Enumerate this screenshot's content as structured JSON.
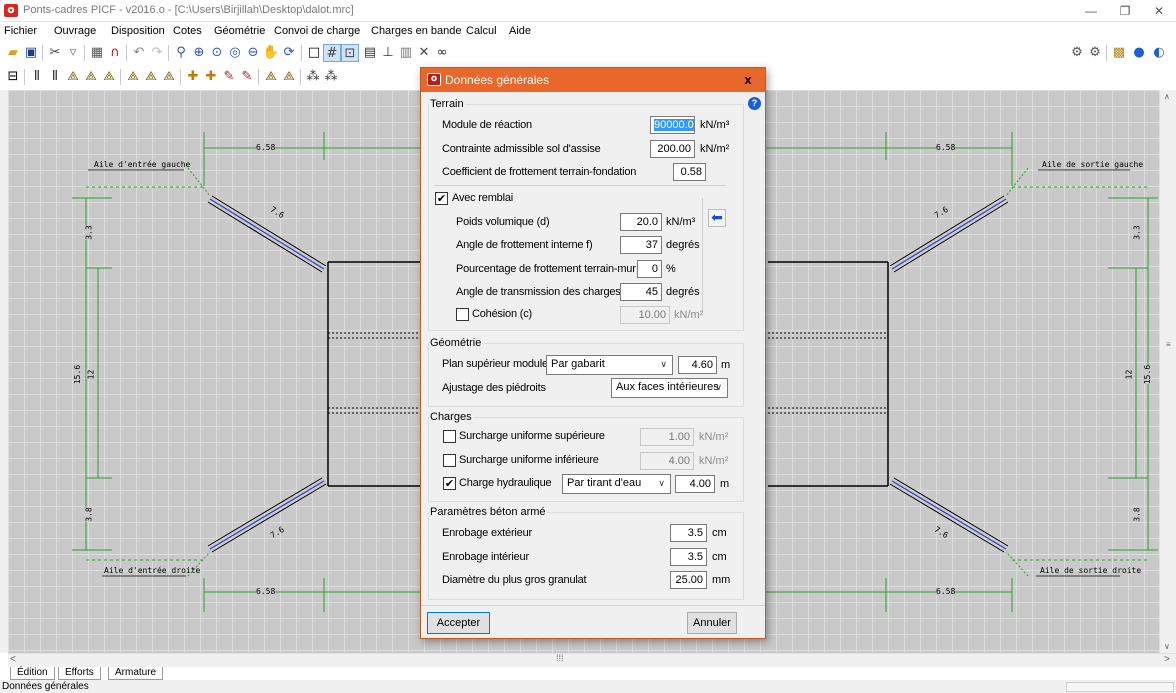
{
  "window": {
    "title": "Ponts-cadres PICF - v2016.o - [C:\\Users\\Birjillah\\Desktop\\dalot.mrc]",
    "controls": [
      "—",
      "❐",
      "✕"
    ]
  },
  "menu": [
    "Fichier",
    "Ouvrage",
    "Disposition",
    "Cotes",
    "Géométrie",
    "Convoi de charge",
    "Charges en bande",
    "Calcul",
    "Aide"
  ],
  "toolbar1_icons": [
    "open-icon",
    "save-icon",
    "cut-icon",
    "paste-icon",
    "image-icon",
    "magnet-icon",
    "undo-icon",
    "redo-icon",
    "zoom-in-icon",
    "zoom-all-icon",
    "zoom-window-icon",
    "zoom-extents-icon",
    "zoom-prev-icon",
    "pan-icon",
    "redraw-icon",
    "frame-icon",
    "grid-icon",
    "snap-icon",
    "print-icon",
    "elevation-icon",
    "preview-icon",
    "tools-icon",
    "binoculars-icon"
  ],
  "toolbar_right_icons": [
    "settings-icon",
    "options-icon",
    "calculate-icon",
    "help-icon",
    "internet-icon"
  ],
  "canvas": {
    "labels": {
      "wing_in_left": "Aile d'entrée gauche",
      "wing_out_left": "Aile de sortie gauche",
      "wing_in_right": "Aile d'entrée droite",
      "wing_out_right": "Aile de sortie droite",
      "dim_658": "6.58",
      "dim_76": "7.6",
      "dim_33": "3.3",
      "dim_38": "3.8",
      "dim_156": "15.6",
      "dim_12": "12"
    }
  },
  "tabs": [
    "Édition",
    "Efforts",
    "Armature"
  ],
  "status": "Données générales",
  "dialog": {
    "title": "Données générales",
    "close": "x",
    "help": "?",
    "terrain": {
      "title": "Terrain",
      "module_label": "Module de réaction",
      "module_value": "90000.0",
      "module_unit": "kN/m³",
      "contrainte_label": "Contrainte admissible sol d'assise",
      "contrainte_value": "200.00",
      "contrainte_unit": "kN/m²",
      "frottement_label": "Coefficient de frottement terrain-fondation",
      "frottement_value": "0.58",
      "remblai_label": "Avec remblai",
      "remblai_checked": true,
      "poids_label": "Poids volumique (d)",
      "poids_value": "20.0",
      "poids_unit": "kN/m³",
      "angle_label": "Angle de frottement interne f)",
      "angle_value": "37",
      "angle_unit": "degrés",
      "pourc_label": "Pourcentage de frottement terrain-mur",
      "pourc_value": "0",
      "pourc_unit": "%",
      "trans_label": "Angle de transmission des charges",
      "trans_value": "45",
      "trans_unit": "degrés",
      "cohesion_label": "Cohésion (c)",
      "cohesion_checked": false,
      "cohesion_value": "10.00",
      "cohesion_unit": "kN/m²"
    },
    "geometrie": {
      "title": "Géométrie",
      "plan_label": "Plan supérieur module",
      "plan_select": "Par gabarit",
      "plan_value": "4.60",
      "plan_unit": "m",
      "ajustage_label": "Ajustage des piédroits",
      "ajustage_select": "Aux faces intérieures"
    },
    "charges": {
      "title": "Charges",
      "sup_label": "Surcharge uniforme supérieure",
      "sup_checked": false,
      "sup_value": "1.00",
      "sup_unit": "kN/m²",
      "inf_label": "Surcharge uniforme inférieure",
      "inf_checked": false,
      "inf_value": "4.00",
      "inf_unit": "kN/m²",
      "hydro_label": "Charge hydraulique",
      "hydro_checked": true,
      "hydro_select": "Par tirant d'eau",
      "hydro_value": "4.00",
      "hydro_unit": "m"
    },
    "beton": {
      "title": "Paramètres béton armé",
      "ext_label": "Enrobage extérieur",
      "ext_value": "3.5",
      "ext_unit": "cm",
      "int_label": "Enrobage intérieur",
      "int_value": "3.5",
      "int_unit": "cm",
      "gran_label": "Diamètre du plus gros granulat",
      "gran_value": "25.00",
      "gran_unit": "mm"
    },
    "accept": "Accepter",
    "cancel": "Annuler"
  },
  "colors": {
    "dialog_title": "#e8672b",
    "dimension_green": "#2e9e2e",
    "wing_blue": "#2a3fd0"
  }
}
